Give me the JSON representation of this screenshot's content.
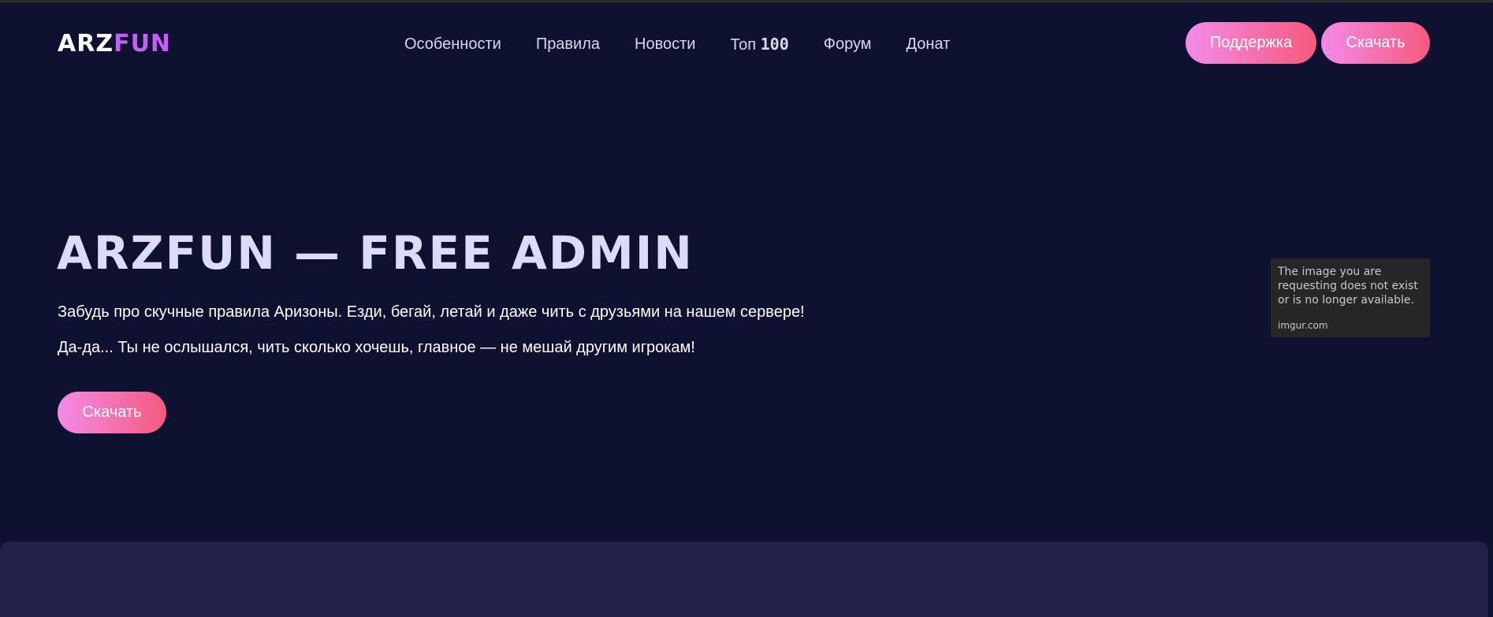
{
  "header": {
    "logo": {
      "part1": "ARZ",
      "part2": "FUN"
    },
    "nav": [
      {
        "label": "Особенности"
      },
      {
        "label": "Правила"
      },
      {
        "label": "Новости"
      },
      {
        "label": "Топ ",
        "num": "100"
      },
      {
        "label": "Форум"
      },
      {
        "label": "Донат"
      }
    ],
    "support_label": "Поддержка",
    "download_label": "Скачать"
  },
  "hero": {
    "title": "ARZFUN — FREE ADMIN",
    "text1": "Забудь про скучные правила Аризоны. Езди, бегай, летай и даже чить с друзьями на нашем сервере!",
    "text2": "Да-да... Ты не ослышался, чить сколько хочешь, главное — не мешай другим игрокам!",
    "download_label": "Скачать"
  },
  "image_placeholder": {
    "message": "The image you are requesting does not exist or is no longer available.",
    "source": "imgur.com"
  },
  "colors": {
    "background": "#0f1130",
    "accent_gradient_start": "#f38be8",
    "accent_gradient_end": "#f55a7c",
    "logo_accent": "#c55ef5",
    "lower_section": "#21214a"
  }
}
